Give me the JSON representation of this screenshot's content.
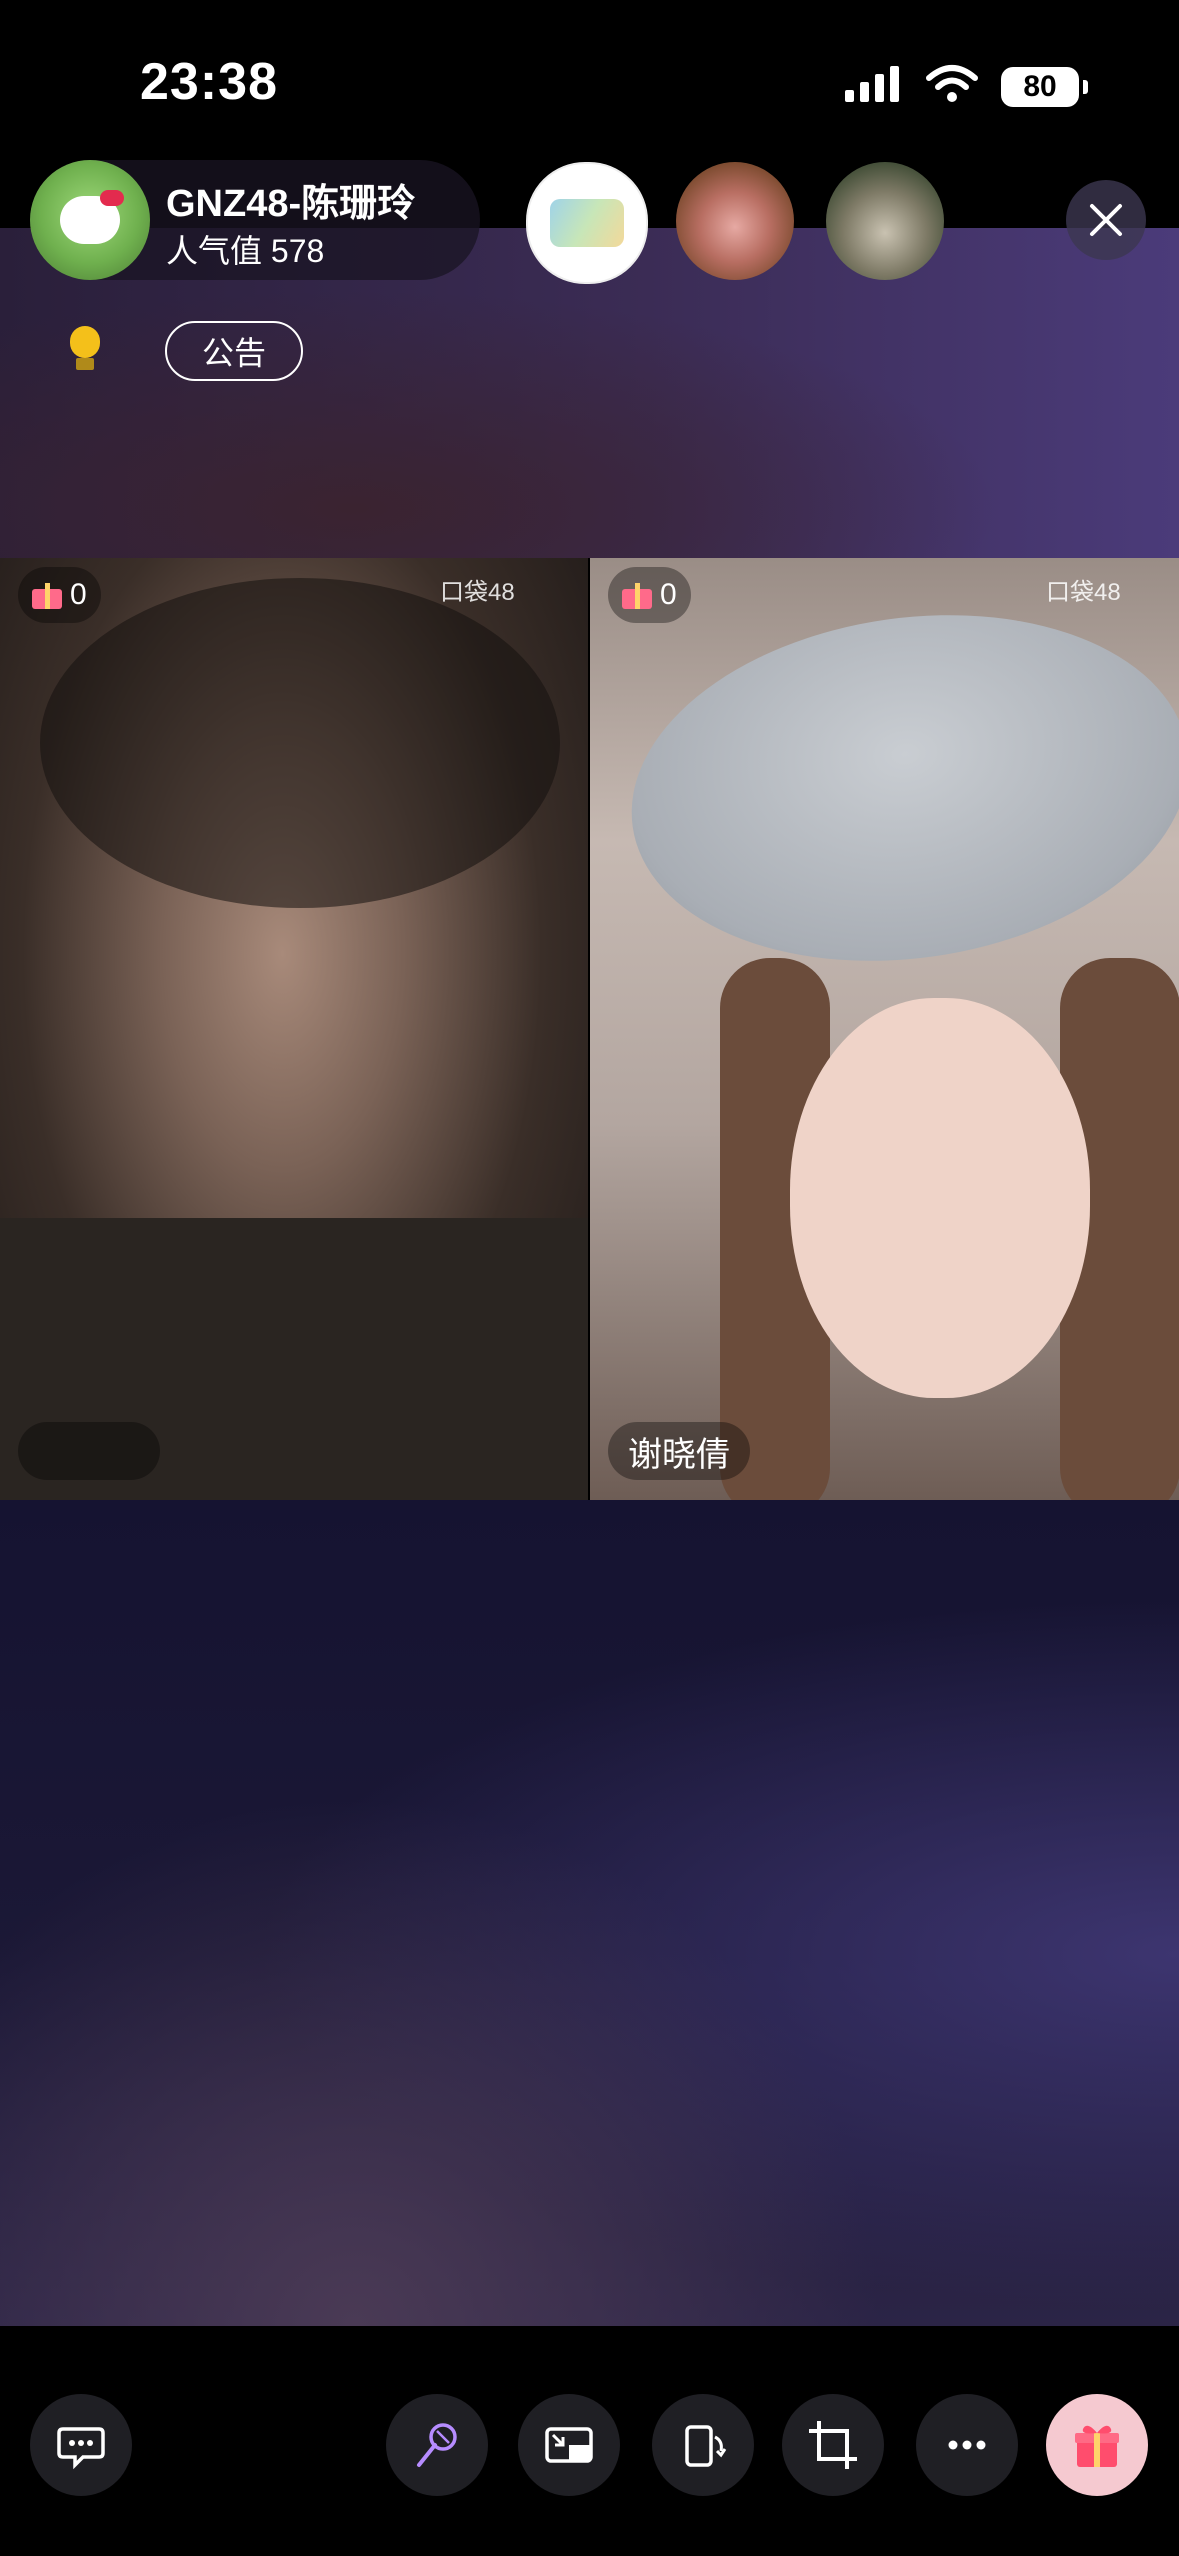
{
  "status_bar": {
    "time": "23:38",
    "battery": "80",
    "signal_icon": "cellular-signal-icon",
    "wifi_icon": "wifi-icon"
  },
  "host": {
    "name": "GNZ48-陈珊玲",
    "popularity": "人气值 578",
    "avatar_icon": "hello-kitty-avatar"
  },
  "viewers": [
    {
      "avatar": "sticker-avatar"
    },
    {
      "avatar": "pig-avatar"
    },
    {
      "avatar": "cat-avatar"
    }
  ],
  "notice_button": "公告",
  "streams": [
    {
      "gift_count": "0",
      "watermark": "口袋48",
      "name": ""
    },
    {
      "gift_count": "0",
      "watermark": "口袋48",
      "name": "谢晓倩"
    }
  ],
  "toolbar": {
    "buttons": [
      "chat-icon",
      "microphone-icon",
      "picture-in-picture-icon",
      "rotate-screen-icon",
      "crop-icon",
      "more-icon",
      "gift-icon"
    ]
  },
  "colors": {
    "gift_accent": "#ff6a8a",
    "background": "#1b1836",
    "toolbar_button": "#1f1f24"
  }
}
